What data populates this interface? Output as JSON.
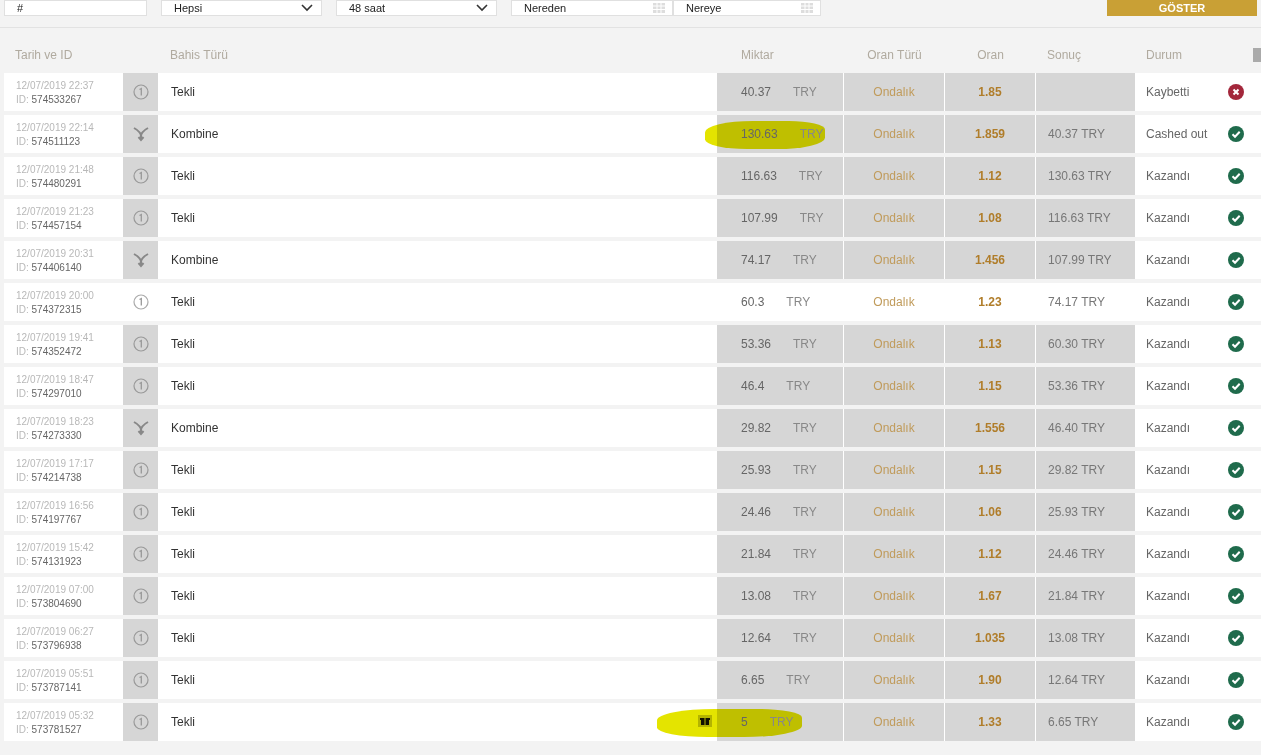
{
  "filters": {
    "bet_id": {
      "value": "#"
    },
    "bet_type": {
      "value": "Hepsi"
    },
    "period": {
      "value": "48 saat"
    },
    "date_from": {
      "placeholder": "Nereden"
    },
    "date_to": {
      "placeholder": "Nereye"
    },
    "submit": "GÖSTER"
  },
  "table": {
    "columns": [
      "Tarih ve ID",
      "Bahis Türü",
      "Miktar",
      "Oran Türü",
      "Oran",
      "Sonuç",
      "Durum"
    ],
    "rows": [
      {
        "date": "12/07/2019 22:37",
        "id_label": "ID:",
        "id": "574533267",
        "kind": "single",
        "type": "Tekli",
        "amount": "40.37",
        "currency": "TRY",
        "odds_type": "Ondalık",
        "odds": "1.85",
        "status": "Kaybetti",
        "won": false,
        "highlighted": false,
        "marked": false,
        "bonus": false
      },
      {
        "date": "12/07/2019 22:14",
        "id_label": "ID:",
        "id": "574511123",
        "kind": "combo",
        "type": "Kombine",
        "amount": "130.63",
        "currency": "TRY",
        "odds_type": "Ondalık",
        "odds": "1.859",
        "result": "40.37 TRY",
        "status": "Cashed out",
        "won": true,
        "highlighted": false,
        "marked": true,
        "bonus": false
      },
      {
        "date": "12/07/2019 21:48",
        "id_label": "ID:",
        "id": "574480291",
        "kind": "single",
        "type": "Tekli",
        "amount": "116.63",
        "currency": "TRY",
        "odds_type": "Ondalık",
        "odds": "1.12",
        "result": "130.63 TRY",
        "status": "Kazandı",
        "won": true,
        "highlighted": false,
        "marked": false,
        "bonus": false
      },
      {
        "date": "12/07/2019 21:23",
        "id_label": "ID:",
        "id": "574457154",
        "kind": "single",
        "type": "Tekli",
        "amount": "107.99",
        "currency": "TRY",
        "odds_type": "Ondalık",
        "odds": "1.08",
        "result": "116.63 TRY",
        "status": "Kazandı",
        "won": true,
        "highlighted": false,
        "marked": false,
        "bonus": false
      },
      {
        "date": "12/07/2019 20:31",
        "id_label": "ID:",
        "id": "574406140",
        "kind": "combo",
        "type": "Kombine",
        "amount": "74.17",
        "currency": "TRY",
        "odds_type": "Ondalık",
        "odds": "1.456",
        "result": "107.99 TRY",
        "status": "Kazandı",
        "won": true,
        "highlighted": false,
        "marked": false,
        "bonus": false
      },
      {
        "date": "12/07/2019 20:00",
        "id_label": "ID:",
        "id": "574372315",
        "kind": "single",
        "type": "Tekli",
        "amount": "60.3",
        "currency": "TRY",
        "odds_type": "Ondalık",
        "odds": "1.23",
        "result": "74.17 TRY",
        "status": "Kazandı",
        "won": true,
        "highlighted": true,
        "marked": false,
        "bonus": false
      },
      {
        "date": "12/07/2019 19:41",
        "id_label": "ID:",
        "id": "574352472",
        "kind": "single",
        "type": "Tekli",
        "amount": "53.36",
        "currency": "TRY",
        "odds_type": "Ondalık",
        "odds": "1.13",
        "result": "60.30 TRY",
        "status": "Kazandı",
        "won": true,
        "highlighted": false,
        "marked": false,
        "bonus": false
      },
      {
        "date": "12/07/2019 18:47",
        "id_label": "ID:",
        "id": "574297010",
        "kind": "single",
        "type": "Tekli",
        "amount": "46.4",
        "currency": "TRY",
        "odds_type": "Ondalık",
        "odds": "1.15",
        "result": "53.36 TRY",
        "status": "Kazandı",
        "won": true,
        "highlighted": false,
        "marked": false,
        "bonus": false
      },
      {
        "date": "12/07/2019 18:23",
        "id_label": "ID:",
        "id": "574273330",
        "kind": "combo",
        "type": "Kombine",
        "amount": "29.82",
        "currency": "TRY",
        "odds_type": "Ondalık",
        "odds": "1.556",
        "result": "46.40 TRY",
        "status": "Kazandı",
        "won": true,
        "highlighted": false,
        "marked": false,
        "bonus": false
      },
      {
        "date": "12/07/2019 17:17",
        "id_label": "ID:",
        "id": "574214738",
        "kind": "single",
        "type": "Tekli",
        "amount": "25.93",
        "currency": "TRY",
        "odds_type": "Ondalık",
        "odds": "1.15",
        "result": "29.82 TRY",
        "status": "Kazandı",
        "won": true,
        "highlighted": false,
        "marked": false,
        "bonus": false
      },
      {
        "date": "12/07/2019 16:56",
        "id_label": "ID:",
        "id": "574197767",
        "kind": "single",
        "type": "Tekli",
        "amount": "24.46",
        "currency": "TRY",
        "odds_type": "Ondalık",
        "odds": "1.06",
        "result": "25.93 TRY",
        "status": "Kazandı",
        "won": true,
        "highlighted": false,
        "marked": false,
        "bonus": false
      },
      {
        "date": "12/07/2019 15:42",
        "id_label": "ID:",
        "id": "574131923",
        "kind": "single",
        "type": "Tekli",
        "amount": "21.84",
        "currency": "TRY",
        "odds_type": "Ondalık",
        "odds": "1.12",
        "result": "24.46 TRY",
        "status": "Kazandı",
        "won": true,
        "highlighted": false,
        "marked": false,
        "bonus": false
      },
      {
        "date": "12/07/2019 07:00",
        "id_label": "ID:",
        "id": "573804690",
        "kind": "single",
        "type": "Tekli",
        "amount": "13.08",
        "currency": "TRY",
        "odds_type": "Ondalık",
        "odds": "1.67",
        "result": "21.84 TRY",
        "status": "Kazandı",
        "won": true,
        "highlighted": false,
        "marked": false,
        "bonus": false
      },
      {
        "date": "12/07/2019 06:27",
        "id_label": "ID:",
        "id": "573796938",
        "kind": "single",
        "type": "Tekli",
        "amount": "12.64",
        "currency": "TRY",
        "odds_type": "Ondalık",
        "odds": "1.035",
        "result": "13.08 TRY",
        "status": "Kazandı",
        "won": true,
        "highlighted": false,
        "marked": false,
        "bonus": false
      },
      {
        "date": "12/07/2019 05:51",
        "id_label": "ID:",
        "id": "573787141",
        "kind": "single",
        "type": "Tekli",
        "amount": "6.65",
        "currency": "TRY",
        "odds_type": "Ondalık",
        "odds": "1.90",
        "result": "12.64 TRY",
        "status": "Kazandı",
        "won": true,
        "highlighted": false,
        "marked": false,
        "bonus": false
      },
      {
        "date": "12/07/2019 05:32",
        "id_label": "ID:",
        "id": "573781527",
        "kind": "single",
        "type": "Tekli",
        "amount": "5",
        "currency": "TRY",
        "odds_type": "Ondalık",
        "odds": "1.33",
        "result": "6.65 TRY",
        "status": "Kazandı",
        "won": true,
        "highlighted": false,
        "marked": true,
        "bonus": true
      }
    ]
  }
}
